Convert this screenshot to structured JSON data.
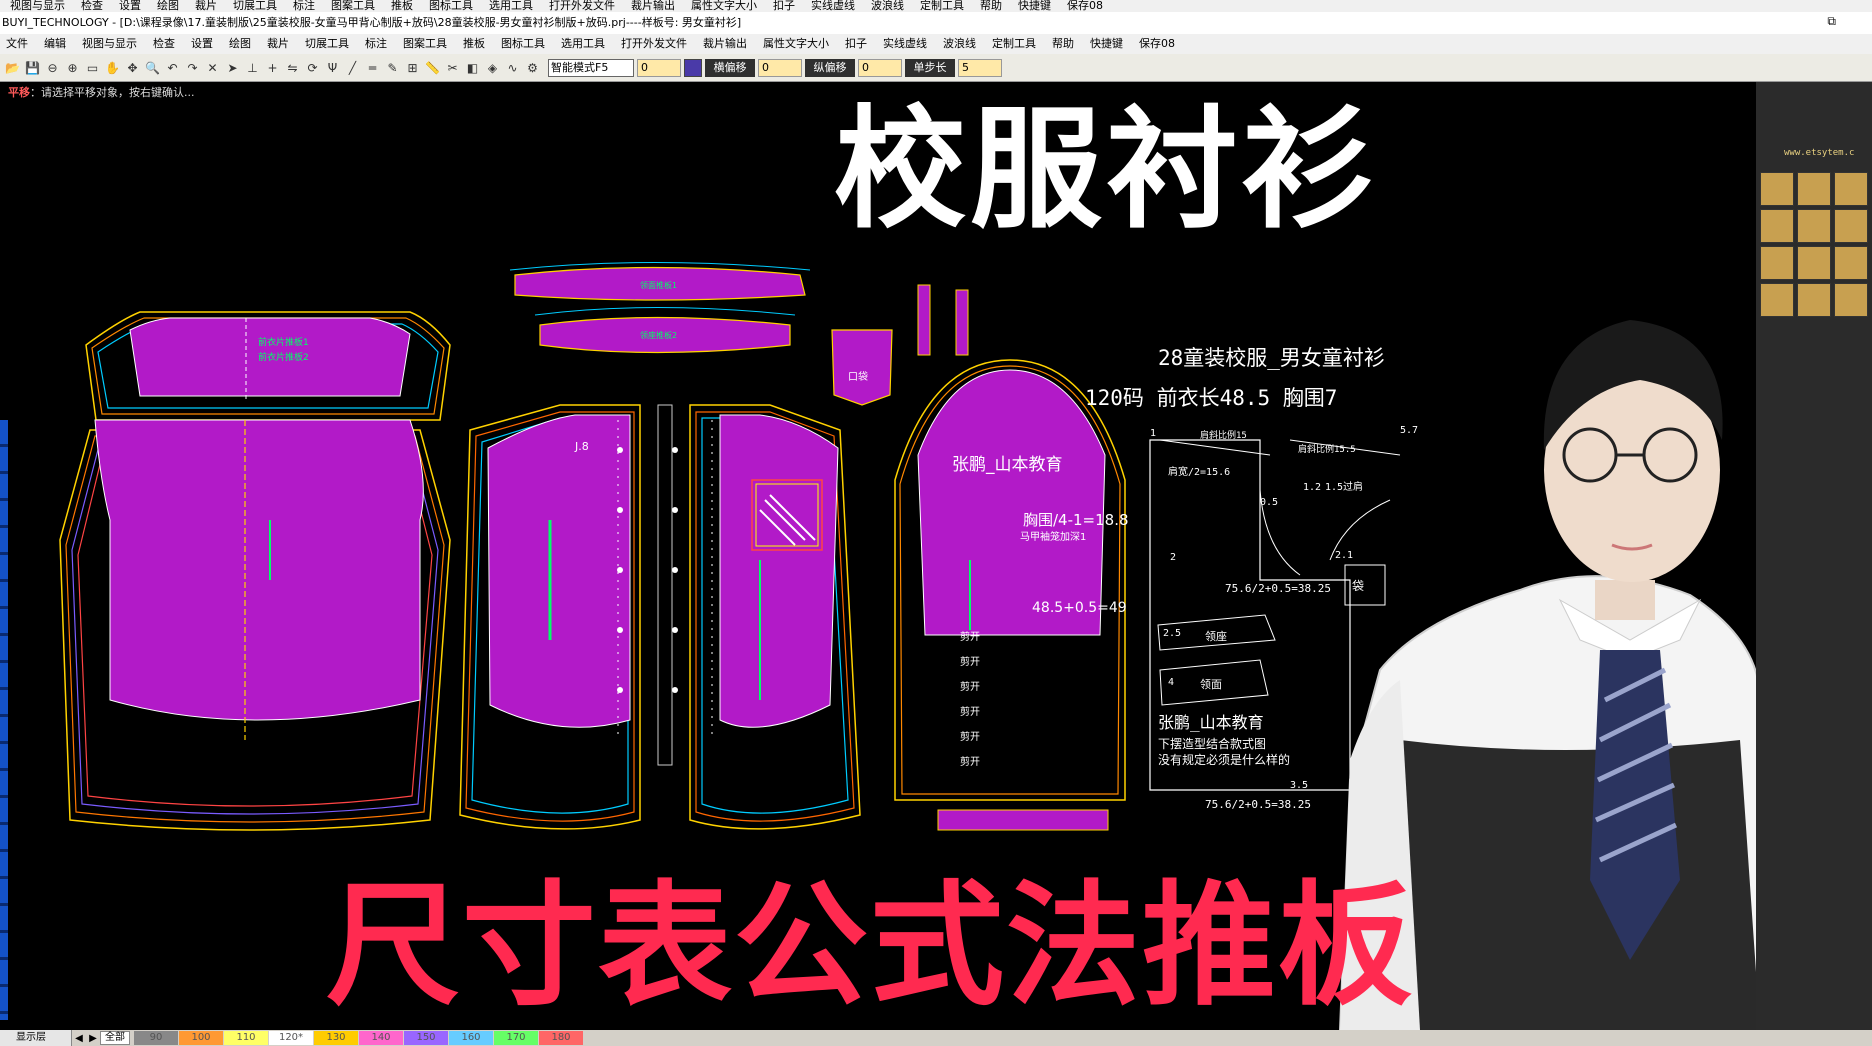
{
  "ghost_menu": [
    "视图与显示",
    "检查",
    "设置",
    "绘图",
    "裁片",
    "切展工具",
    "标注",
    "图案工具",
    "推板",
    "图标工具",
    "选用工具",
    "打开外发文件",
    "裁片输出",
    "属性文字大小",
    "扣子",
    "实线虚线",
    "波浪线",
    "定制工具",
    "帮助",
    "快捷键",
    "保存08"
  ],
  "app": {
    "title": "BUYI_TECHNOLOGY - [D:\\课程录像\\17.童装制版\\25童装校服-女童马甲背心制版+放码\\28童装校服-男女童衬衫制版+放码.prj----样板号: 男女童衬衫]",
    "restore_glyph": "⧉"
  },
  "menu": [
    "文件",
    "编辑",
    "视图与显示",
    "检查",
    "设置",
    "绘图",
    "裁片",
    "切展工具",
    "标注",
    "图案工具",
    "推板",
    "图标工具",
    "选用工具",
    "打开外发文件",
    "裁片输出",
    "属性文字大小",
    "扣子",
    "实线虚线",
    "波浪线",
    "定制工具",
    "帮助",
    "快捷键",
    "保存08"
  ],
  "toolbar": {
    "mode_select": "智能模式F5",
    "fields": [
      {
        "label": "",
        "value": "0"
      },
      {
        "label": "横偏移",
        "value": "0"
      },
      {
        "label": "纵偏移",
        "value": "0"
      },
      {
        "label": "单步长",
        "value": "5"
      }
    ]
  },
  "status": {
    "prefix": "平移",
    "message": "：请选择平移对象，按右键确认..."
  },
  "cad": {
    "yoke_text1": "前衣片推板1",
    "yoke_text2": "前衣片推板2",
    "collar_text1": "领面推板1",
    "collar_text2": "领座推板2",
    "bodice_label_front": "J.8",
    "pocket_label": "口袋",
    "sleeve_teacher": "张鹏_山本教育",
    "sleeve_chest": "胸围/4-1=18.8",
    "sleeve_note": "马甲袖笼加深1",
    "sleeve_calc": "48.5+0.5=49",
    "pins": [
      "剪开",
      "剪开",
      "剪开",
      "剪开",
      "剪开",
      "剪开"
    ]
  },
  "draft": {
    "title": "28童装校服_男女童衬衫",
    "size_line": "120码  前衣长48.5  胸围7",
    "shoulder": "肩斜比例15",
    "shoulder2": "肩斜比例15.5",
    "neck_w": "肩宽/2=15.6",
    "yoke": "1.5过肩",
    "armhole": "0.5",
    "v57": "5.7",
    "v12": "1.2",
    "bust_formula": "75.6/2+0.5=38.25",
    "pocket_label": "袋",
    "collar_top": "领座",
    "collar_bottom": "领面",
    "v25": "2.5",
    "v4": "4",
    "teacher": "张鹏_山本教育",
    "note1": "下摆造型结合款式图",
    "note2": "没有规定必须是什么样的",
    "v35": "3.5",
    "hem_formula": "75.6/2+0.5=38.25",
    "v2": "2",
    "v1": "1",
    "v2_1": "2.1"
  },
  "right_panel": {
    "url": "www.etsytem.c"
  },
  "bottom": {
    "layer_label": "显示层",
    "arrow_left": "◀",
    "arrow_right": "▶",
    "all": "全部",
    "sizes": [
      "90",
      "100",
      "110",
      "120*",
      "130",
      "140",
      "150",
      "160",
      "170",
      "180"
    ],
    "size_colors": [
      "#888888",
      "#ff9933",
      "#ffff66",
      "#ffffff",
      "#ffcc00",
      "#ff66cc",
      "#9966ff",
      "#66ccff",
      "#66ff66",
      "#ff6666"
    ]
  },
  "overlay": {
    "top": "校服衬衫",
    "bottom": "尺寸表公式法推板"
  },
  "colors": {
    "panel_fill": "#b21ac8",
    "banner_bottom": "#ff2a50"
  }
}
